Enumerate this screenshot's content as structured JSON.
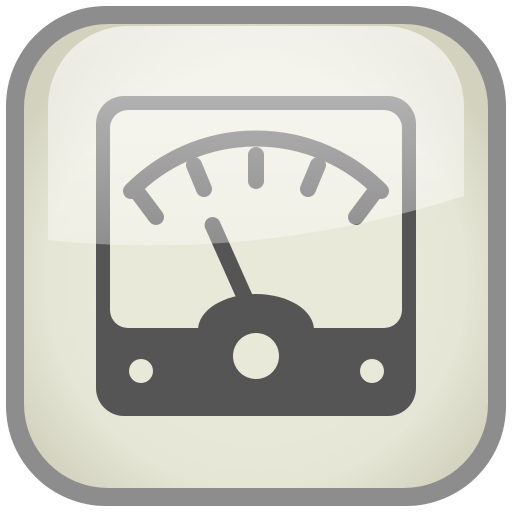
{
  "icon": {
    "name": "analog-meter-icon",
    "needle_level": 0.3,
    "colors": {
      "frame": "#8d8d8d",
      "tile": "#e9e9da",
      "tile_edge": "#d2d2bf",
      "glyph": "#555555",
      "highlight": "#ffffff"
    }
  }
}
